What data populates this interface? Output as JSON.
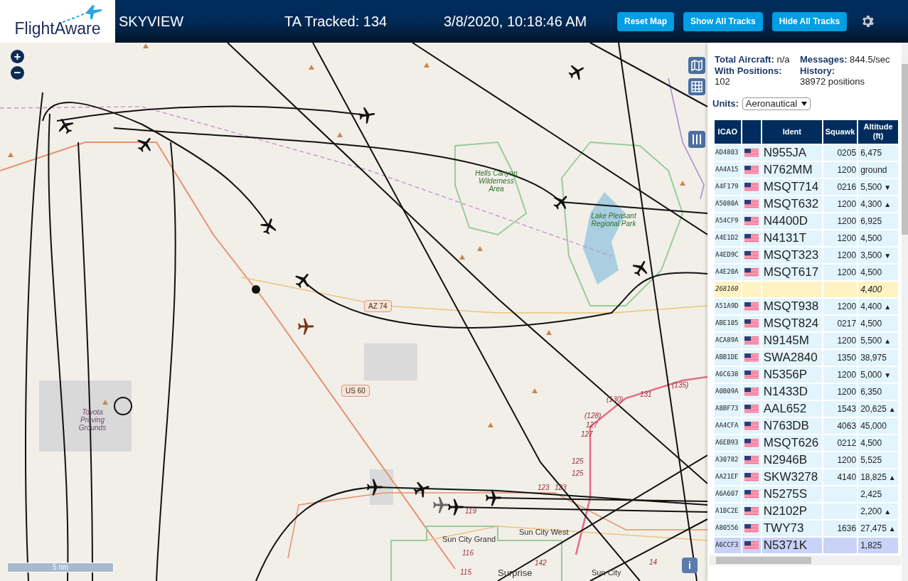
{
  "header": {
    "logo": "FlightAware",
    "title": "SKYVIEW",
    "tracked": "TA Tracked: 134",
    "datetime": "3/8/2020, 10:18:46 AM",
    "buttons": [
      "Reset Map",
      "Show All Tracks",
      "Hide All Tracks"
    ]
  },
  "map": {
    "zoom_in": "+",
    "zoom_out": "−",
    "scale": "5 nm",
    "info": "i",
    "labels": [
      {
        "text": "Hells Canyon Wilderness Area",
        "kind": "park"
      },
      {
        "text": "Lake Pleasant Regional Park",
        "kind": "park"
      },
      {
        "text": "AZ 74",
        "kind": "shield"
      },
      {
        "text": "(135)",
        "kind": "route"
      },
      {
        "text": "US 60",
        "kind": "shield"
      },
      {
        "text": "131",
        "kind": "route"
      },
      {
        "text": "(130)",
        "kind": "route"
      },
      {
        "text": "Toyota Proving Grounds",
        "kind": "area"
      },
      {
        "text": "(128)",
        "kind": "route"
      },
      {
        "text": "127",
        "kind": "route"
      },
      {
        "text": "127",
        "kind": "route"
      },
      {
        "text": "125",
        "kind": "route"
      },
      {
        "text": "125",
        "kind": "route"
      },
      {
        "text": "123",
        "kind": "route"
      },
      {
        "text": "123",
        "kind": "route"
      },
      {
        "text": "119",
        "kind": "route"
      },
      {
        "text": "Sun City West",
        "kind": "town"
      },
      {
        "text": "Sun City Grand",
        "kind": "town"
      },
      {
        "text": "116",
        "kind": "route"
      },
      {
        "text": "14",
        "kind": "route"
      },
      {
        "text": "142",
        "kind": "route"
      },
      {
        "text": "115",
        "kind": "route"
      },
      {
        "text": "Surprise",
        "kind": "city"
      },
      {
        "text": "Sun City",
        "kind": "town"
      }
    ]
  },
  "stats": [
    {
      "label": "Total Aircraft:",
      "value": "n/a"
    },
    {
      "label": "Messages:",
      "value": "844.5/sec"
    },
    {
      "label": "With Positions:",
      "value": "102"
    },
    {
      "label": "History:",
      "value": "38972 positions"
    }
  ],
  "units": {
    "label": "Units:",
    "value": "Aeronautical"
  },
  "table": {
    "columns": [
      "ICAO",
      "",
      "Ident",
      "Squawk",
      "Altitude (ft)"
    ],
    "rows": [
      {
        "icao": "AD4803",
        "flag": true,
        "ident": "N955JA",
        "squawk": "0205",
        "altitude": "6,475",
        "trend": "",
        "kind": "adsb",
        "selected": false
      },
      {
        "icao": "AA4A15",
        "flag": true,
        "ident": "N762MM",
        "squawk": "1200",
        "altitude": "ground",
        "trend": "",
        "kind": "adsb",
        "selected": false
      },
      {
        "icao": "A4F179",
        "flag": true,
        "ident": "MSQT714",
        "squawk": "0216",
        "altitude": "5,500",
        "trend": "▼",
        "kind": "adsb",
        "selected": false
      },
      {
        "icao": "A5080A",
        "flag": true,
        "ident": "MSQT632",
        "squawk": "1200",
        "altitude": "4,300",
        "trend": "▲",
        "kind": "adsb",
        "selected": false
      },
      {
        "icao": "A54CF9",
        "flag": true,
        "ident": "N4400D",
        "squawk": "1200",
        "altitude": "6,925",
        "trend": "",
        "kind": "adsb",
        "selected": false
      },
      {
        "icao": "A4E1D2",
        "flag": true,
        "ident": "N4131T",
        "squawk": "1200",
        "altitude": "4,500",
        "trend": "",
        "kind": "adsb",
        "selected": false
      },
      {
        "icao": "A4ED9C",
        "flag": true,
        "ident": "MSQT323",
        "squawk": "1200",
        "altitude": "3,500",
        "trend": "▼",
        "kind": "adsb",
        "selected": false
      },
      {
        "icao": "A4E20A",
        "flag": true,
        "ident": "MSQT617",
        "squawk": "1200",
        "altitude": "4,500",
        "trend": "",
        "kind": "adsb",
        "selected": false
      },
      {
        "icao": "268160",
        "flag": false,
        "ident": "",
        "squawk": "",
        "altitude": "4,400",
        "trend": "",
        "kind": "other",
        "selected": false
      },
      {
        "icao": "A51A9D",
        "flag": true,
        "ident": "MSQT938",
        "squawk": "1200",
        "altitude": "4,400",
        "trend": "▲",
        "kind": "adsb",
        "selected": false
      },
      {
        "icao": "ABE105",
        "flag": true,
        "ident": "MSQT824",
        "squawk": "0217",
        "altitude": "4,500",
        "trend": "",
        "kind": "adsb",
        "selected": false
      },
      {
        "icao": "ACA89A",
        "flag": true,
        "ident": "N9145M",
        "squawk": "1200",
        "altitude": "5,500",
        "trend": "▲",
        "kind": "adsb",
        "selected": false
      },
      {
        "icao": "ABB1DE",
        "flag": true,
        "ident": "SWA2840",
        "squawk": "1350",
        "altitude": "38,975",
        "trend": "",
        "kind": "adsb",
        "selected": false
      },
      {
        "icao": "A6C638",
        "flag": true,
        "ident": "N5356P",
        "squawk": "1200",
        "altitude": "5,000",
        "trend": "▼",
        "kind": "adsb",
        "selected": false
      },
      {
        "icao": "A0B09A",
        "flag": true,
        "ident": "N1433D",
        "squawk": "1200",
        "altitude": "6,350",
        "trend": "",
        "kind": "adsb",
        "selected": false
      },
      {
        "icao": "A8BF73",
        "flag": true,
        "ident": "AAL652",
        "squawk": "1543",
        "altitude": "20,625",
        "trend": "▲",
        "kind": "adsb",
        "selected": false
      },
      {
        "icao": "AA4CFA",
        "flag": true,
        "ident": "N763DB",
        "squawk": "4063",
        "altitude": "45,000",
        "trend": "",
        "kind": "adsb",
        "selected": false
      },
      {
        "icao": "A6EB93",
        "flag": true,
        "ident": "MSQT626",
        "squawk": "0212",
        "altitude": "4,500",
        "trend": "",
        "kind": "adsb",
        "selected": false
      },
      {
        "icao": "A30782",
        "flag": true,
        "ident": "N2946B",
        "squawk": "1200",
        "altitude": "5,525",
        "trend": "",
        "kind": "adsb",
        "selected": false
      },
      {
        "icao": "AA21EF",
        "flag": true,
        "ident": "SKW3278",
        "squawk": "4140",
        "altitude": "18,825",
        "trend": "▲",
        "kind": "adsb",
        "selected": false
      },
      {
        "icao": "A6A607",
        "flag": true,
        "ident": "N5275S",
        "squawk": "",
        "altitude": "2,425",
        "trend": "",
        "kind": "adsb",
        "selected": false
      },
      {
        "icao": "A1BC2E",
        "flag": true,
        "ident": "N2102P",
        "squawk": "",
        "altitude": "2,200",
        "trend": "▲",
        "kind": "adsb",
        "selected": false
      },
      {
        "icao": "A80556",
        "flag": true,
        "ident": "TWY73",
        "squawk": "1636",
        "altitude": "27,475",
        "trend": "▲",
        "kind": "adsb",
        "selected": false
      },
      {
        "icao": "A6CCF3",
        "flag": true,
        "ident": "N5371K",
        "squawk": "",
        "altitude": "1,825",
        "trend": "",
        "kind": "adsb",
        "selected": true
      }
    ]
  }
}
